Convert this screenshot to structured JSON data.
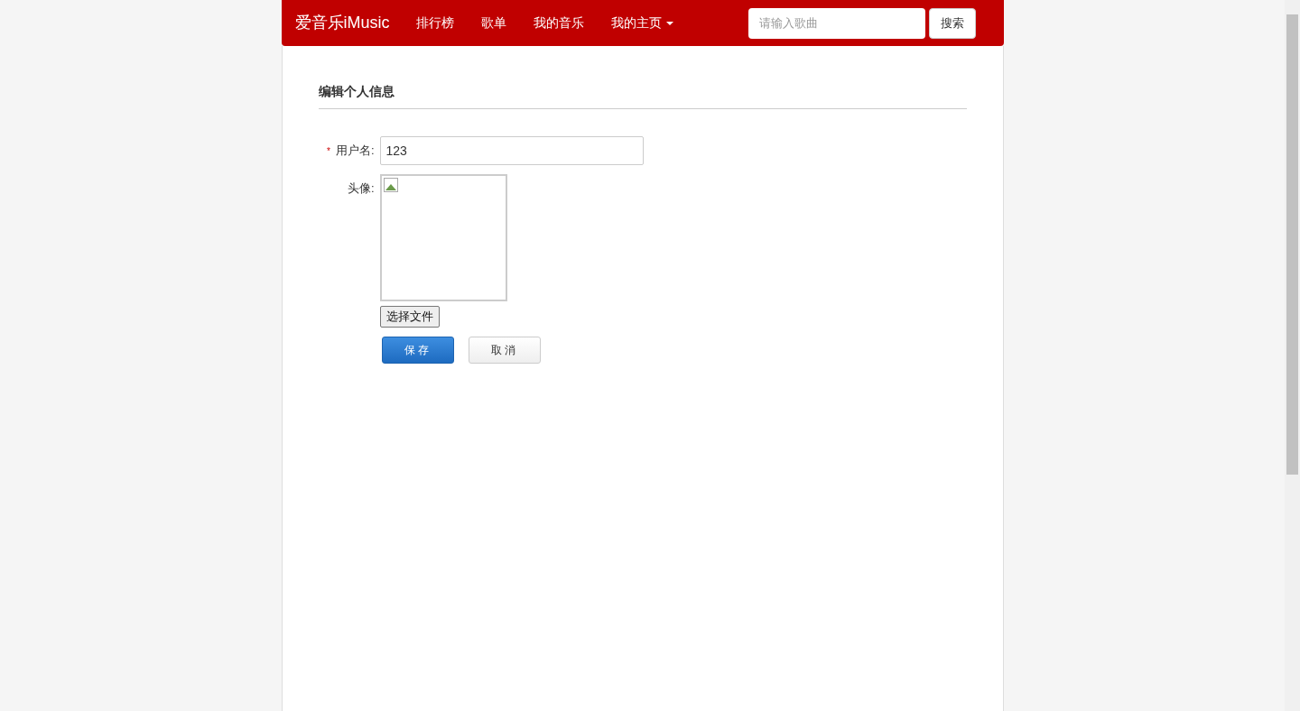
{
  "navbar": {
    "brand": "爱音乐iMusic",
    "links": [
      {
        "label": "排行榜",
        "dropdown": false
      },
      {
        "label": "歌单",
        "dropdown": false
      },
      {
        "label": "我的音乐",
        "dropdown": false
      },
      {
        "label": "我的主页",
        "dropdown": true
      }
    ],
    "search": {
      "placeholder": "请输入歌曲",
      "button": "搜索"
    }
  },
  "form": {
    "title": "编辑个人信息",
    "required_mark": "*",
    "fields": [
      {
        "kind": "text",
        "label": "用户名:",
        "required": true,
        "value": "123"
      },
      {
        "kind": "avatar",
        "label": "头像:",
        "required": false,
        "file_button": "选择文件"
      }
    ],
    "buttons": [
      {
        "label": "保存",
        "primary": true
      },
      {
        "label": "取消",
        "primary": false
      }
    ]
  }
}
